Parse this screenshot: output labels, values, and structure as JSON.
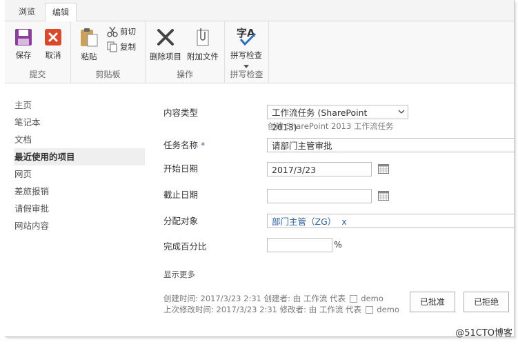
{
  "tabs": [
    {
      "label": "浏览"
    },
    {
      "label": "编辑"
    }
  ],
  "ribbon": {
    "groups": {
      "submit": {
        "label": "提交",
        "save": "保存",
        "cancel": "取消"
      },
      "clipboard": {
        "label": "剪贴板",
        "paste": "粘贴",
        "cut": "剪切",
        "copy": "复制"
      },
      "actions": {
        "label": "操作",
        "delete": "删除项目",
        "attach": "附加文件"
      },
      "spelling": {
        "label": "拼写检查",
        "spell": "拼写检查"
      }
    }
  },
  "nav": {
    "items": [
      {
        "label": "主页"
      },
      {
        "label": "笔记本"
      },
      {
        "label": "文档"
      },
      {
        "label": "最近使用的项目"
      },
      {
        "label": "网页"
      },
      {
        "label": "差旅报销"
      },
      {
        "label": "请假审批"
      },
      {
        "label": "网站内容"
      }
    ]
  },
  "form": {
    "content_type": {
      "label": "内容类型",
      "value": "工作流任务 (SharePoint 2013)",
      "hint": "创建 SharePoint 2013 工作流任务"
    },
    "task_name": {
      "label": "任务名称",
      "required": "*",
      "value": "请部门主管审批"
    },
    "start_date": {
      "label": "开始日期",
      "value": "2017/3/23"
    },
    "due_date": {
      "label": "截止日期",
      "value": ""
    },
    "assigned_to": {
      "label": "分配对象",
      "value": "部门主管（ZG）",
      "remove": "x"
    },
    "percent_complete": {
      "label": "完成百分比",
      "value": "",
      "unit": "%"
    },
    "show_more": "显示更多"
  },
  "meta": {
    "created": "创建时间: 2017/3/23 2:31  创建者: 由 工作流 代表",
    "created_user": "demo",
    "modified": "上次修改时间: 2017/3/23 2:31  修改者: 由 工作流 代表",
    "modified_user": "demo"
  },
  "buttons": {
    "approve": "已批准",
    "reject": "已拒绝"
  },
  "watermark": "@51CTO博客"
}
